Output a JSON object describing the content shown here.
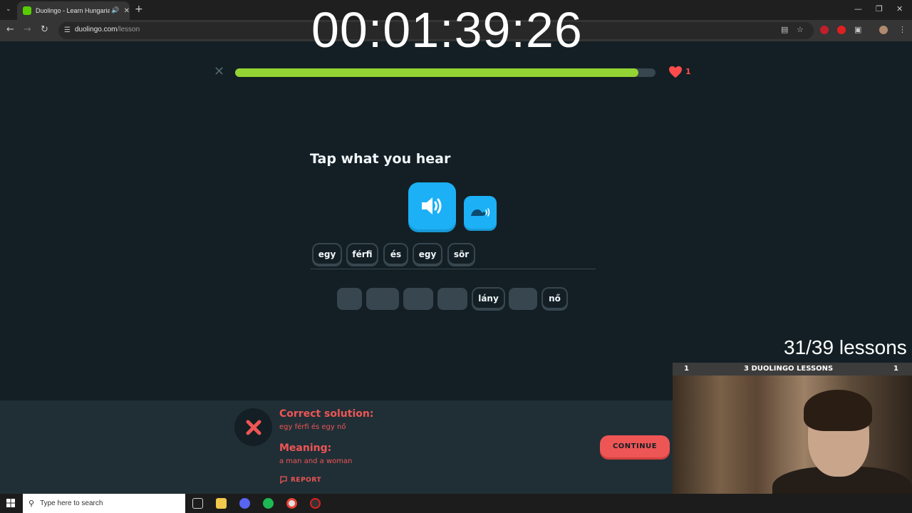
{
  "browser": {
    "tab_title": "Duolingo - Learn Hungarian",
    "url_domain": "duolingo.com",
    "url_path": "/lesson",
    "new_tab_symbol": "+"
  },
  "timer": "00:01:39:26",
  "lesson": {
    "progress": 0.96,
    "hearts": "1",
    "prompt": "Tap what you hear",
    "answer_tiles": [
      "egy",
      "férfi",
      "és",
      "egy",
      "sör"
    ],
    "word_bank": [
      {
        "label": "",
        "used": true
      },
      {
        "label": "",
        "used": true
      },
      {
        "label": "",
        "used": true
      },
      {
        "label": "",
        "used": true
      },
      {
        "label": "lány",
        "used": false
      },
      {
        "label": "",
        "used": true
      },
      {
        "label": "nő",
        "used": false
      }
    ]
  },
  "overlay": {
    "lessons_counter": "31/39 lessons",
    "cam_left": "1",
    "cam_title": "3 DUOLINGO LESSONS",
    "cam_right": "1"
  },
  "feedback": {
    "correct_heading": "Correct solution:",
    "correct_text": "egy férfi és egy nő",
    "meaning_heading": "Meaning:",
    "meaning_text": "a man and a woman",
    "report_label": "REPORT",
    "continue_label": "CONTINUE"
  },
  "taskbar": {
    "search_placeholder": "Type here to search"
  },
  "colors": {
    "background": "#131f24",
    "progress": "#93d333",
    "heart": "#ff4b4b",
    "speaker": "#1cb0f6",
    "error": "#ee5555"
  }
}
